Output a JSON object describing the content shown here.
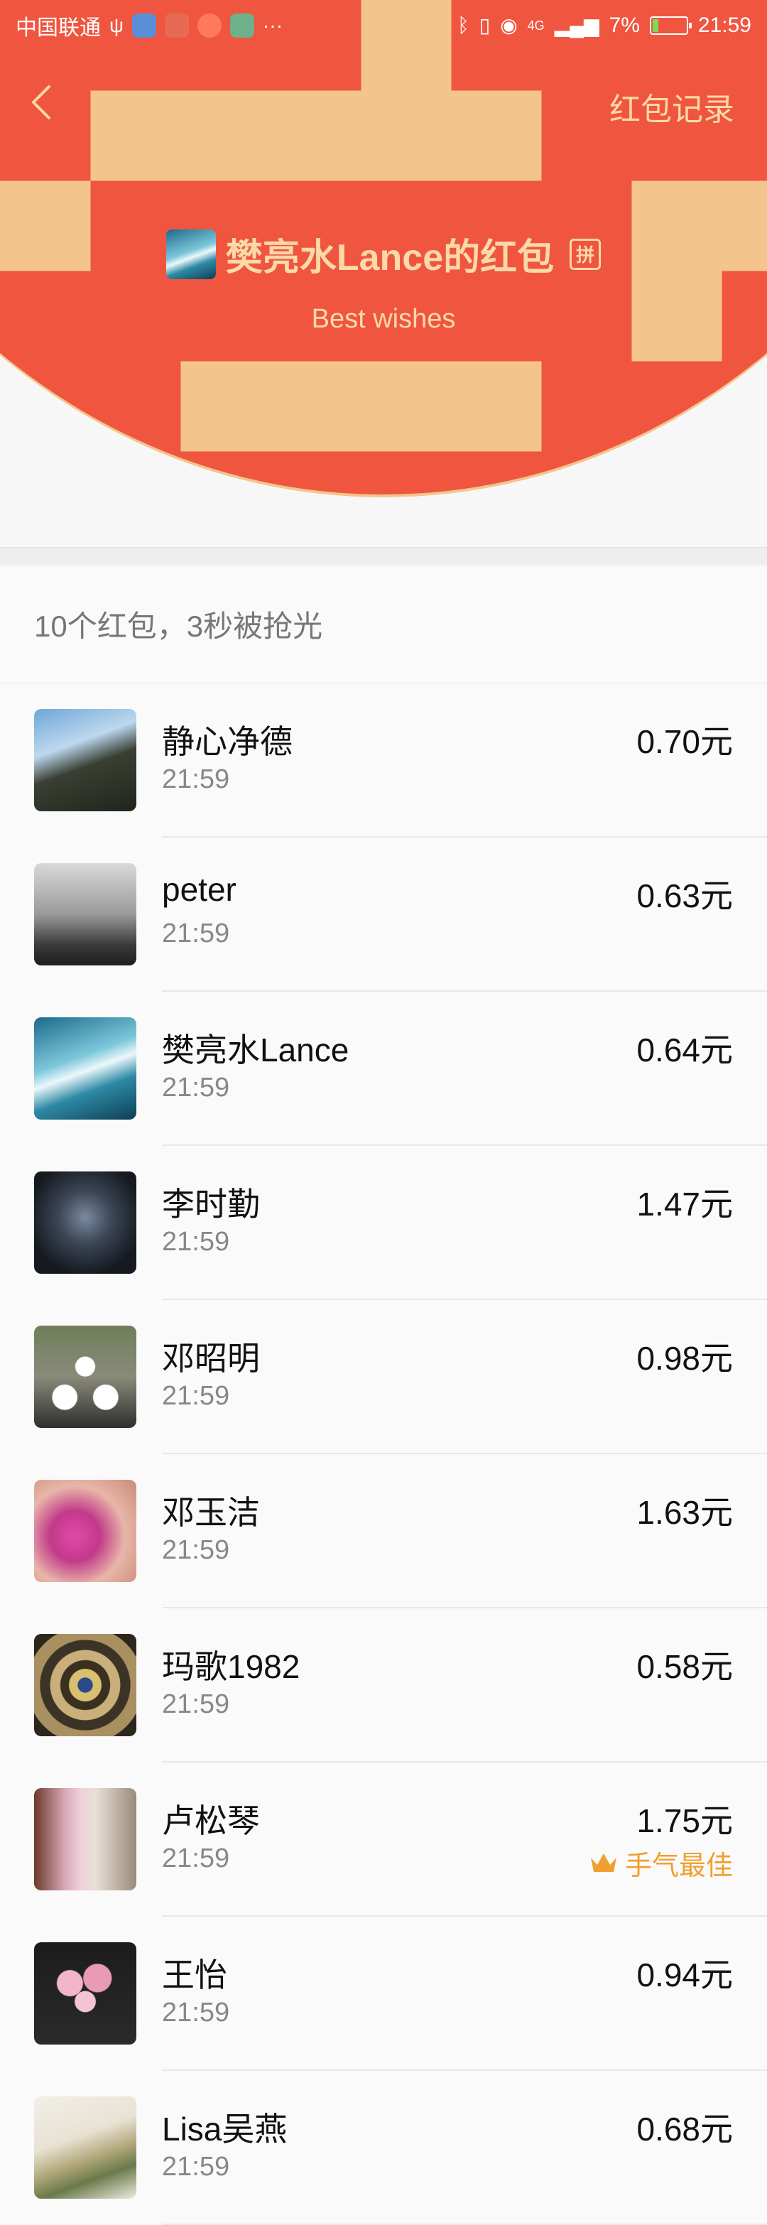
{
  "status_bar": {
    "carrier": "中国联通",
    "battery": "7%",
    "time": "21:59",
    "network": "4G"
  },
  "nav": {
    "record_link": "红包记录"
  },
  "packet": {
    "title": "樊亮水Lance的红包",
    "pin_badge": "拼",
    "subtitle": "Best wishes"
  },
  "summary": "10个红包，3秒被抢光",
  "best_label": "手气最佳",
  "entries": [
    {
      "name": "静心净德",
      "time": "21:59",
      "amount": "0.70元"
    },
    {
      "name": "peter",
      "time": "21:59",
      "amount": "0.63元"
    },
    {
      "name": "樊亮水Lance",
      "time": "21:59",
      "amount": "0.64元"
    },
    {
      "name": "李时勤",
      "time": "21:59",
      "amount": "1.47元"
    },
    {
      "name": "邓昭明",
      "time": "21:59",
      "amount": "0.98元"
    },
    {
      "name": "邓玉洁",
      "time": "21:59",
      "amount": "1.63元"
    },
    {
      "name": "玛歌1982",
      "time": "21:59",
      "amount": "0.58元"
    },
    {
      "name": "卢松琴",
      "time": "21:59",
      "amount": "1.75元",
      "best": true
    },
    {
      "name": "王怡",
      "time": "21:59",
      "amount": "0.94元"
    },
    {
      "name": "Lisa吴燕",
      "time": "21:59",
      "amount": "0.68元"
    }
  ],
  "colors": {
    "header_red": "#f05540",
    "gold_text": "#fbd9a8",
    "best_orange": "#f0a030"
  }
}
